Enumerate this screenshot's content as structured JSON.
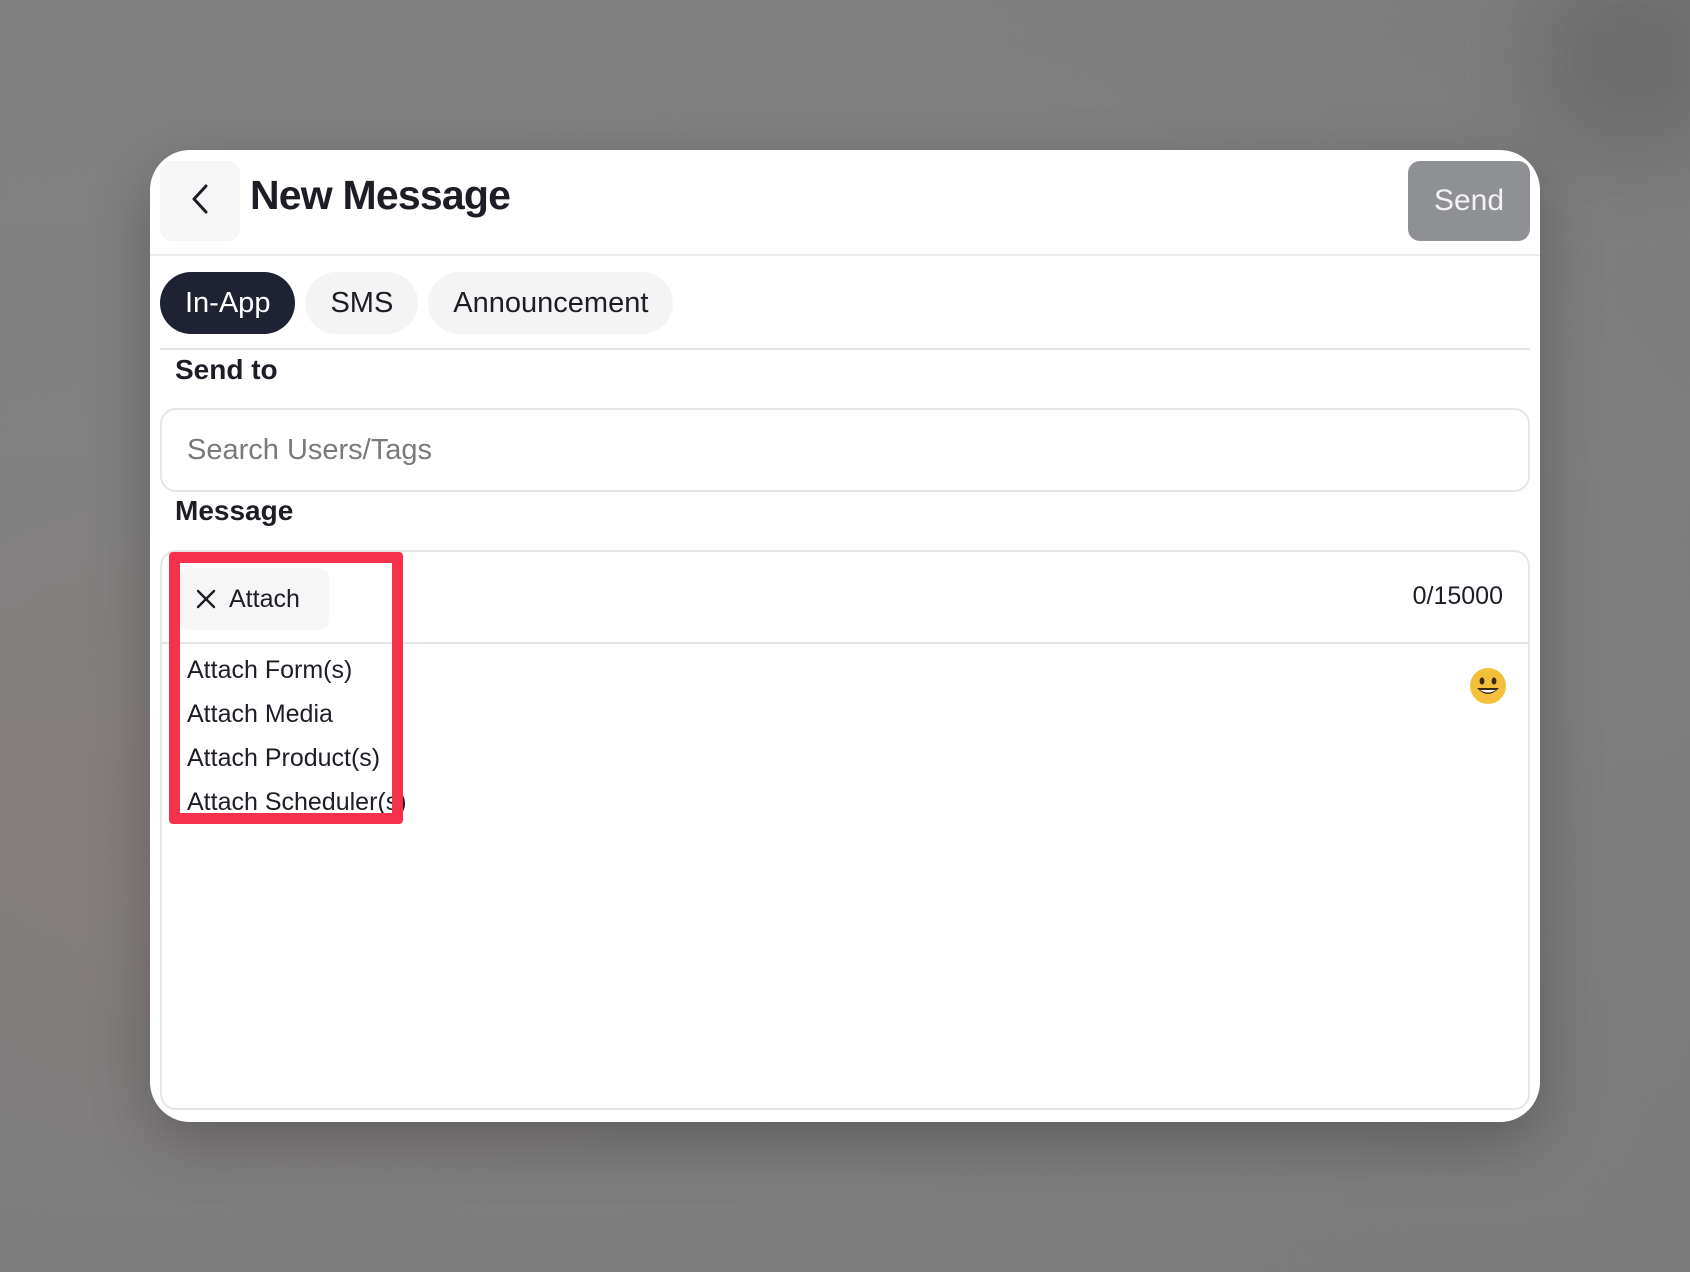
{
  "header": {
    "title": "New Message",
    "send_label": "Send",
    "back_icon": "chevron-left-icon"
  },
  "tabs": [
    {
      "label": "In-App",
      "active": true
    },
    {
      "label": "SMS",
      "active": false
    },
    {
      "label": "Announcement",
      "active": false
    }
  ],
  "send_to": {
    "label": "Send to",
    "placeholder": "Search Users/Tags",
    "value": ""
  },
  "message": {
    "label": "Message",
    "attach_label": "Attach",
    "attach_icon": "close-icon",
    "char_count": "0/15000",
    "emoji_icon": "smiley-emoji-icon",
    "value": "",
    "attach_menu": [
      "Attach Form(s)",
      "Attach Media",
      "Attach Product(s)",
      "Attach Scheduler(s)"
    ]
  },
  "colors": {
    "tab_active": "#1e2232",
    "send_disabled": "#8e9094",
    "highlight": "#f5314b",
    "emoji": "#f4bf3a"
  }
}
